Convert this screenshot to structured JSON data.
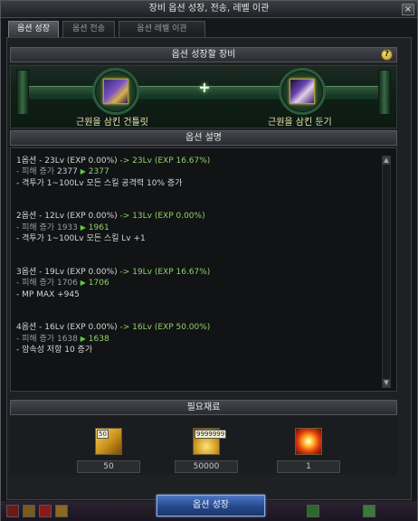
{
  "window": {
    "title": "장비 옵션 성장, 전송, 레벨 이관",
    "close_label": "×"
  },
  "tabs": [
    {
      "label": "옵션 성장",
      "active": true
    },
    {
      "label": "옵션 전송",
      "active": false
    },
    {
      "label": "옵션 레벨 이관",
      "active": false
    }
  ],
  "equip": {
    "header": "옵션 성장할 장비",
    "help_label": "?",
    "plus": "+",
    "left_item": {
      "name": "근원을 삼킨 건틀릿",
      "icon": "gauntlet-icon"
    },
    "right_item": {
      "name": "근원을 삼킨 둔기",
      "icon": "mace-icon"
    }
  },
  "description": {
    "header": "옵션 설명",
    "options": [
      {
        "title": "1옵션 - 23Lv (EXP 0.00%)",
        "arrow_text": " -> 23Lv (EXP 16.67%)",
        "dmg_label": "- 피해 증가",
        "dmg_from": "2377",
        "dmg_to": "2377",
        "effect": "- 격투가 1~100Lv 모든 스킬 공격력 10% 증가"
      },
      {
        "title": "2옵션 - 12Lv (EXP 0.00%)",
        "arrow_text": " -> 13Lv (EXP 0.00%)",
        "dmg_label": "- 피해 증가",
        "dmg_from": "1933",
        "dmg_to": "1961",
        "effect": "- 격투가 1~100Lv 모든 스킬 Lv +1"
      },
      {
        "title": "3옵션 - 19Lv (EXP 0.00%)",
        "arrow_text": " -> 19Lv (EXP 16.67%)",
        "dmg_label": "- 피해 증가",
        "dmg_from": "1706",
        "dmg_to": "1706",
        "effect": "- MP MAX +945"
      },
      {
        "title": "4옵션 - 16Lv (EXP 0.00%)",
        "arrow_text": " -> 16Lv (EXP 50.00%)",
        "dmg_label": "- 피해 증가",
        "dmg_from": "1638",
        "dmg_to": "1638",
        "effect": "- 암속성 저항 10 증가"
      }
    ]
  },
  "materials": {
    "header": "필요재료",
    "items": [
      {
        "icon": "gold-card-icon",
        "badge": "50",
        "count": "50"
      },
      {
        "icon": "gold-coins-icon",
        "badge": "9999999",
        "count": "50000"
      },
      {
        "icon": "fire-burst-icon",
        "badge": "",
        "count": "1"
      }
    ]
  },
  "action": {
    "label": "옵션 성장"
  },
  "colors": {
    "accent_green": "#8fd26a",
    "arrow_green": "#5bcf3c",
    "button_blue": "#27498c"
  }
}
